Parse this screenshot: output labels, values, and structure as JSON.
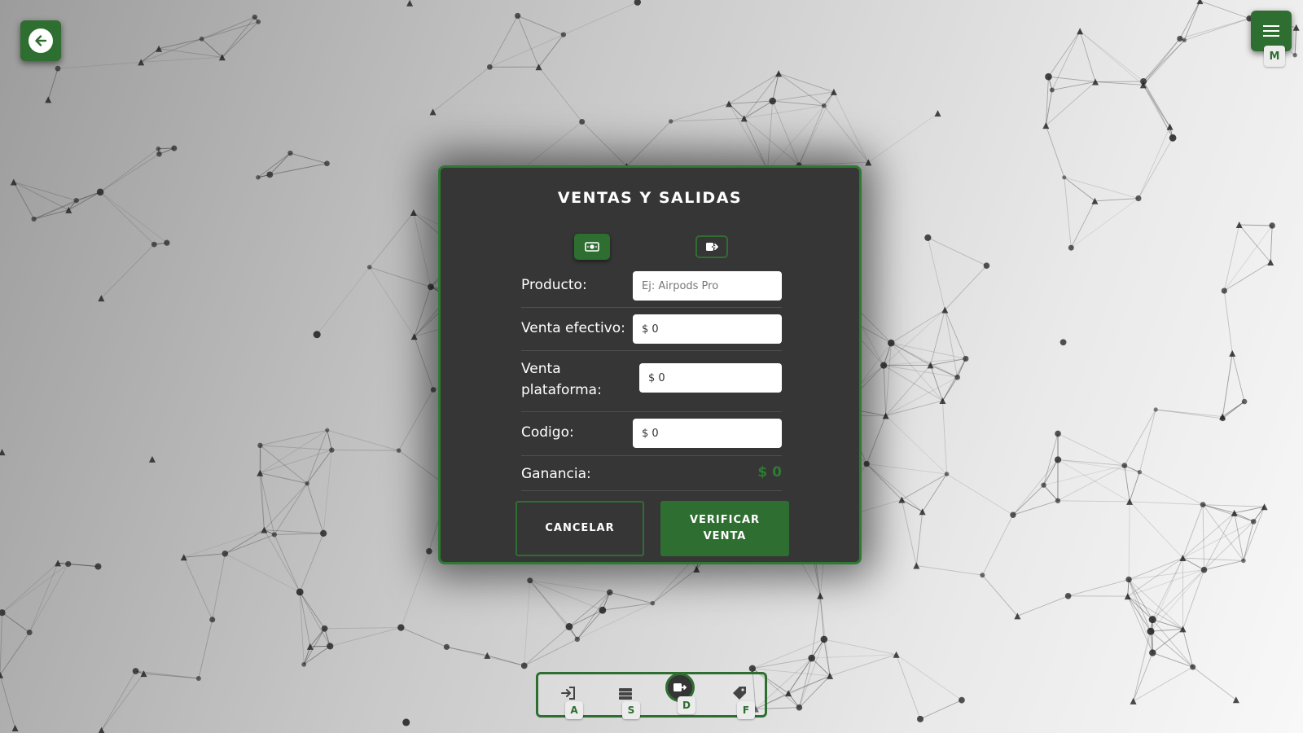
{
  "header": {
    "back_icon": "arrow-left-icon",
    "menu_icon": "hamburger-menu-icon",
    "menu_shortcut": "M"
  },
  "modal": {
    "title": "VENTAS Y SALIDAS",
    "modes": [
      {
        "icon": "money-icon",
        "active": true
      },
      {
        "icon": "exit-icon",
        "active": false
      }
    ],
    "fields": {
      "producto": {
        "label": "Producto:",
        "placeholder": "Ej: Airpods Pro"
      },
      "venta_efectivo": {
        "label": "Venta efectivo:",
        "value": "$ 0"
      },
      "venta_plataforma": {
        "label": "Venta plataforma:",
        "value": "$ 0"
      },
      "codigo": {
        "label": "Codigo:",
        "value": "$ 0"
      }
    },
    "ganancia": {
      "label": "Ganancia:",
      "value": "$ 0"
    },
    "cancel_label": "CANCELAR",
    "verify_label": "VERIFICAR VENTA"
  },
  "bottom_nav": [
    {
      "icon": "login-icon",
      "shortcut": "A",
      "active": false
    },
    {
      "icon": "stack-icon",
      "shortcut": "S",
      "active": false
    },
    {
      "icon": "exit-icon",
      "shortcut": "D",
      "active": true
    },
    {
      "icon": "tag-icon",
      "shortcut": "F",
      "active": false
    }
  ],
  "colors": {
    "accent": "#2f6e31",
    "modal_bg": "#363636",
    "gain_text": "#2f7a33"
  }
}
